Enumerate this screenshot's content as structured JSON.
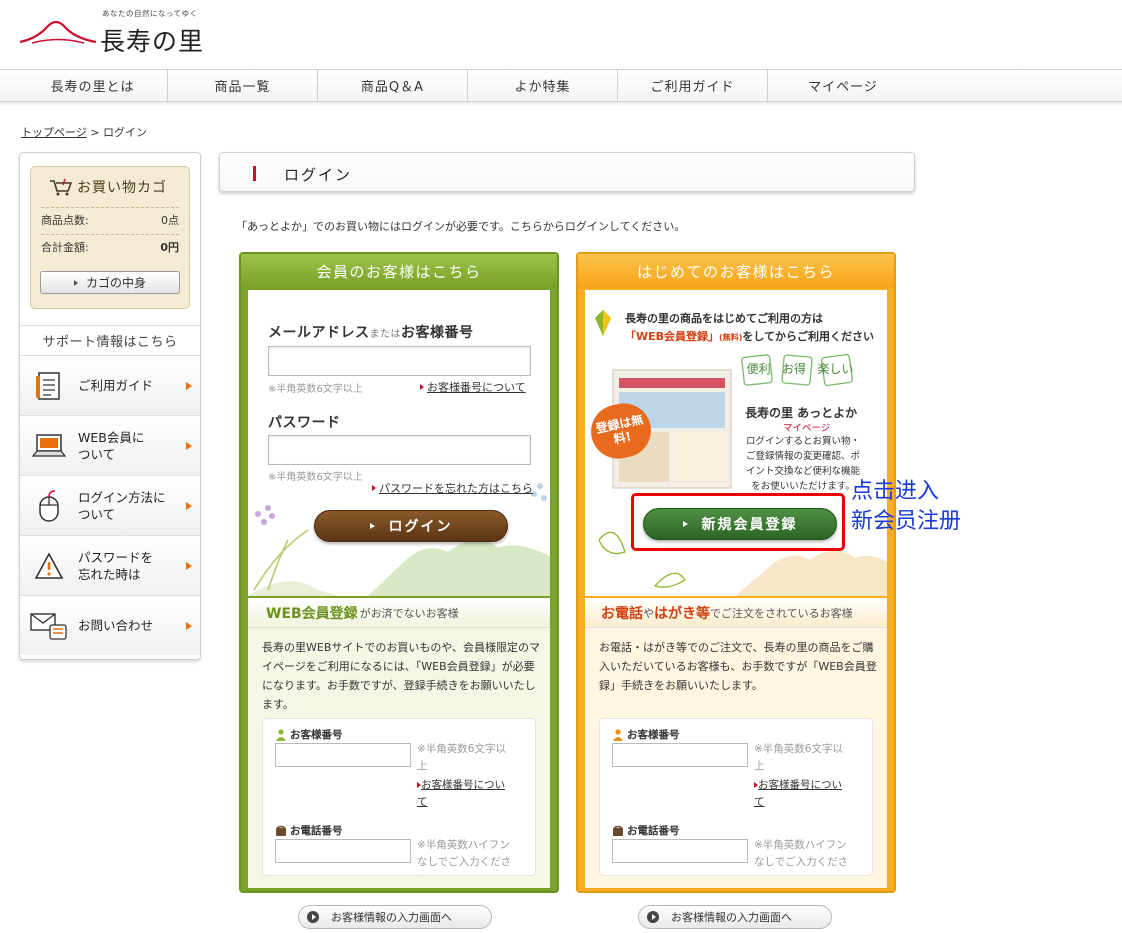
{
  "logo": {
    "tagline": "あなたの自然になってゆく",
    "name": "長寿の里"
  },
  "nav": [
    "長寿の里とは",
    "商品一覧",
    "商品Q＆A",
    "よか特集",
    "ご利用ガイド",
    "マイページ"
  ],
  "breadcrumb": {
    "home": "トップページ",
    "sep": ">",
    "current": "ログイン"
  },
  "cart": {
    "title": "お買い物カゴ",
    "count_label": "商品点数:",
    "count_value": "0点",
    "total_label": "合計金額:",
    "total_value": "0円",
    "button": "カゴの中身"
  },
  "support": {
    "title": "サポート情報はこちら",
    "items": [
      {
        "label": "ご利用ガイド",
        "icon": "document-icon"
      },
      {
        "label": "WEB会員に\nついて",
        "icon": "laptop-icon"
      },
      {
        "label": "ログイン方法に\nついて",
        "icon": "mouse-icon"
      },
      {
        "label": "パスワードを\n忘れた時は",
        "icon": "warning-icon"
      },
      {
        "label": "お問い合わせ",
        "icon": "mail-phone-icon"
      }
    ]
  },
  "page_title": "ログイン",
  "intro": "「あっとよか」でのお買い物にはログインが必要です。こちらからログインしてください。",
  "member": {
    "header": "会員のお客様はこちら",
    "email_label_a": "メールアドレス",
    "email_label_or": "または",
    "email_label_b": "お客様番号",
    "email_note": "※半角英数6文字以上",
    "email_link": "お客様番号について",
    "password_label": "パスワード",
    "password_note": "※半角英数6文字以上",
    "password_link": "パスワードを忘れた方はこちら",
    "login_button": "ログイン",
    "web_header": "WEB会員登録",
    "web_header_small": "がお済でないお客様",
    "web_text": "長寿の里WEBサイトでのお買いものや、会員様限定のマイページをご利用になるには、「WEB会員登録」が必要になります。お手数ですが、登録手続きをお願いいたします。",
    "cust_no_label": "お客様番号",
    "cust_no_note": "※半角英数6文字以上",
    "cust_no_link": "お客様番号について",
    "phone_label": "お電話番号",
    "phone_note": "※半角英数ハイフンなしでご入力ください",
    "next_button": "お客様情報の入力画面へ"
  },
  "new_customer": {
    "header": "はじめてのお客様はこちら",
    "line1": "長寿の里の商品をはじめてご利用の方は",
    "line2_a": "「WEB会員登録」",
    "line2_b": "(無料)",
    "line2_c": "をしてからご利用ください",
    "badge": "登録は無料!",
    "stamps": [
      "便利",
      "お得",
      "楽しい"
    ],
    "brand": "長寿の里 あっとよか",
    "brand_sub": "マイページ",
    "desc": "ログインするとお買い物・ご登録情報の変更確認、ポイント交換など便利な機能をお使いいただけます。",
    "register_button": "新規会員登録",
    "phone_header": "お電話",
    "phone_header_b": "や",
    "phone_header_c": "はがき等",
    "phone_header_small": "でご注文をされているお客様",
    "phone_text": "お電話・はがき等でのご注文で、長寿の里の商品をご購入いただいているお客様も、お手数ですが「WEB会員登録」手続きをお願いいたします。",
    "cust_no_label": "お客様番号",
    "cust_no_note": "※半角英数6文字以上",
    "cust_no_link": "お客様番号について",
    "phone_label": "お電話番号",
    "phone_note": "※半角英数ハイフンなしでご入力ください",
    "next_button": "お客様情報の入力画面へ"
  },
  "annotation": {
    "line1": "点击进入",
    "line2": "新会员注册"
  },
  "colors": {
    "brand_red": "#c8102e",
    "green": "#7aa22b",
    "orange": "#f6ad22",
    "annotation": "#1a3ad8",
    "highlight": "#ee0000"
  }
}
